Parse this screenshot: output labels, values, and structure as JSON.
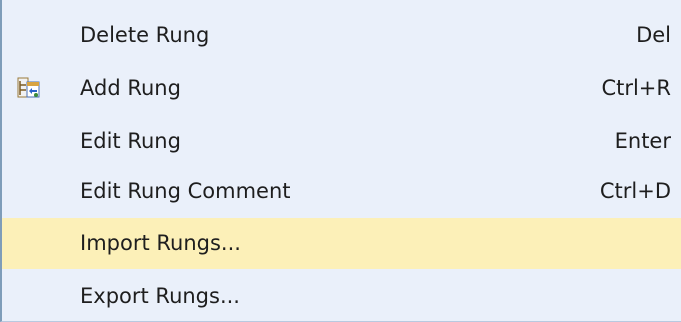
{
  "menu": {
    "items": [
      {
        "label": "Delete Rung",
        "shortcut": "Del",
        "icon": ""
      },
      {
        "label": "Add Rung",
        "shortcut": "Ctrl+R",
        "icon": "add-rung-icon"
      },
      {
        "label": "Edit Rung",
        "shortcut": "Enter",
        "icon": ""
      },
      {
        "label": "Edit Rung Comment",
        "shortcut": "Ctrl+D",
        "icon": ""
      },
      {
        "label": "Import Rungs...",
        "shortcut": "",
        "icon": ""
      },
      {
        "label": "Export Rungs...",
        "shortcut": "",
        "icon": ""
      }
    ],
    "highlighted_index": 4,
    "colors": {
      "background": "#eaf0fa",
      "highlight": "#fcf0b8",
      "text": "#1e1e1e",
      "border": "#7f9db9"
    }
  }
}
